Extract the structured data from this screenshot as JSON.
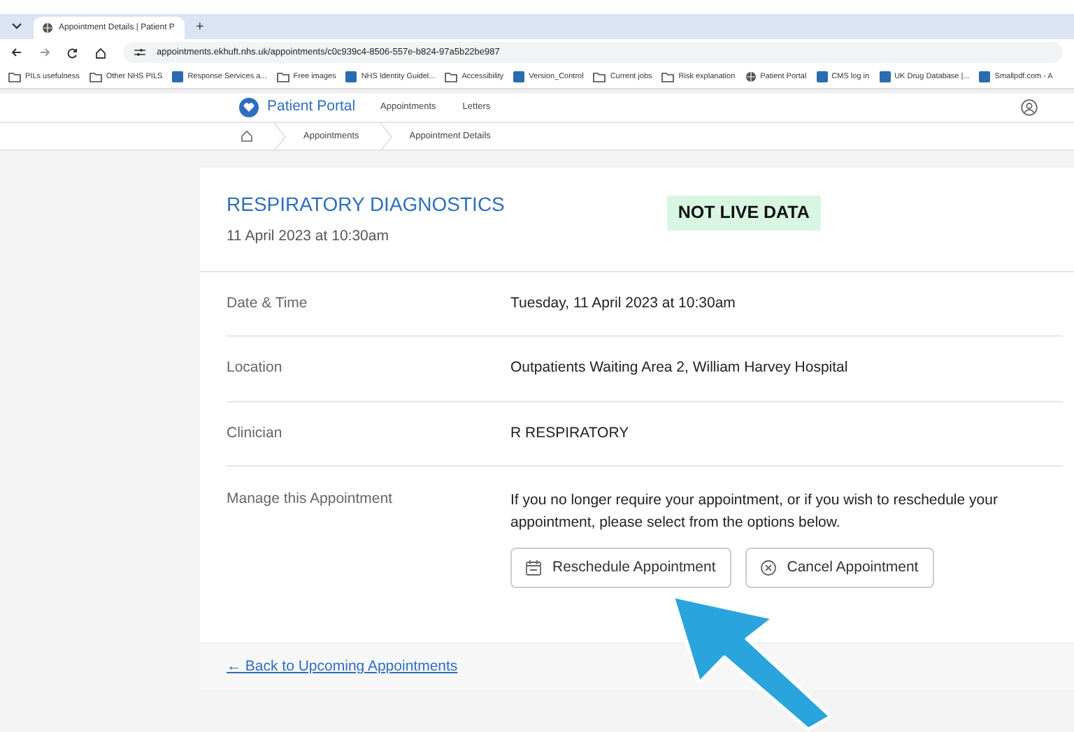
{
  "browser": {
    "tab_title": "Appointment Details | Patient P",
    "new_tab": "+",
    "url": "appointments.ekhuft.nhs.uk/appointments/c0c939c4-8506-557e-b824-97a5b22be987",
    "bookmarks": [
      {
        "label": "PILs usefulness",
        "kind": "folder"
      },
      {
        "label": "Other NHS PILS",
        "kind": "folder"
      },
      {
        "label": "Response Services a...",
        "kind": "site"
      },
      {
        "label": "Free images",
        "kind": "folder"
      },
      {
        "label": "NHS Identity Guidel...",
        "kind": "site"
      },
      {
        "label": "Accessibility",
        "kind": "folder"
      },
      {
        "label": "Version_Control",
        "kind": "site"
      },
      {
        "label": "Current jobs",
        "kind": "folder"
      },
      {
        "label": "Risk explanation",
        "kind": "folder"
      },
      {
        "label": "Patient Portal",
        "kind": "globe"
      },
      {
        "label": "CMS log in",
        "kind": "site"
      },
      {
        "label": "UK Drug Database |...",
        "kind": "site"
      },
      {
        "label": "Smallpdf.com - A",
        "kind": "site"
      }
    ]
  },
  "nav": {
    "brand": "Patient Portal",
    "links": [
      "Appointments",
      "Letters"
    ]
  },
  "breadcrumb": [
    "Appointments",
    "Appointment Details"
  ],
  "appointment": {
    "title": "RESPIRATORY DIAGNOSTICS",
    "subtitle": "11 April 2023 at 10:30am",
    "badge": "NOT LIVE DATA",
    "details": [
      {
        "label": "Date & Time",
        "value": "Tuesday, 11 April 2023 at 10:30am"
      },
      {
        "label": "Location",
        "value": "Outpatients Waiting Area 2, William Harvey Hospital"
      },
      {
        "label": "Clinician",
        "value": "R RESPIRATORY"
      }
    ],
    "manage": {
      "label": "Manage this Appointment",
      "text": "If you no longer require your appointment, or if you wish to reschedule your appointment, please select from the options below.",
      "buttons": [
        {
          "label": "Reschedule Appointment",
          "kind": "reschedule"
        },
        {
          "label": "Cancel Appointment",
          "kind": "cancel"
        }
      ]
    },
    "back_link": "← Back to Upcoming Appointments"
  }
}
